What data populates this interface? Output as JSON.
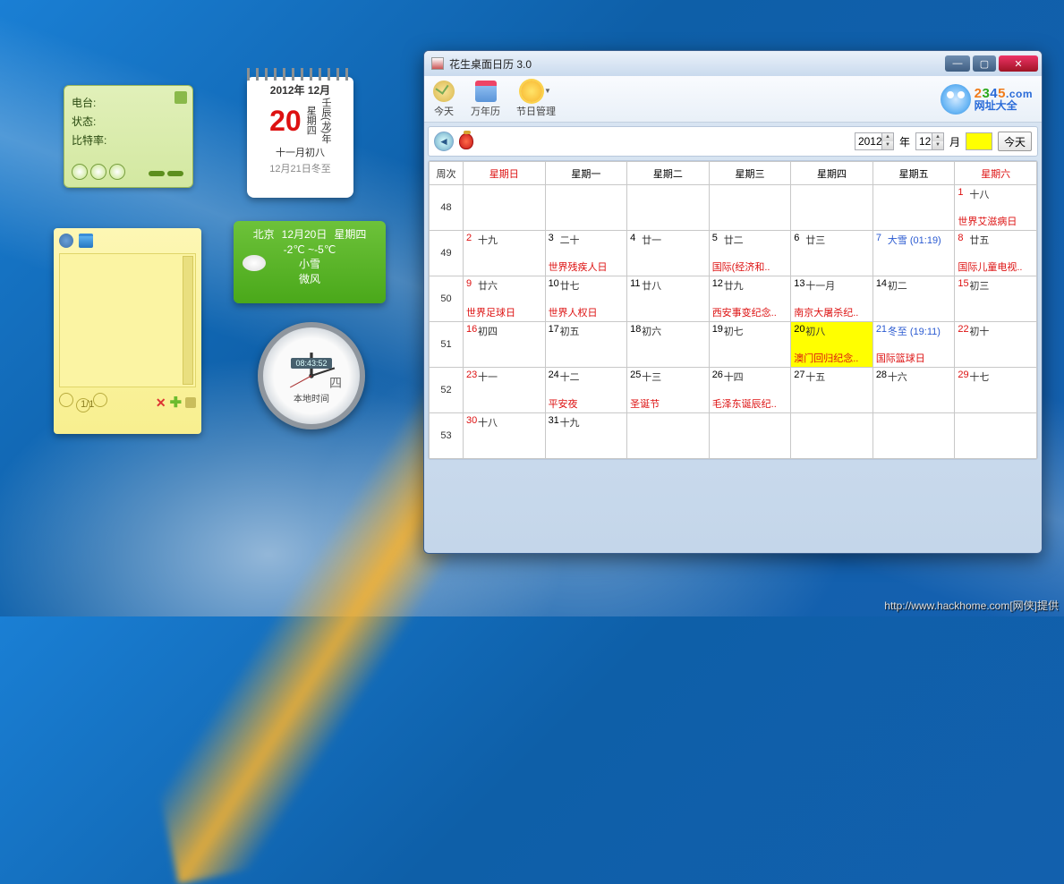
{
  "radio": {
    "station_label": "电台:",
    "status_label": "状态:",
    "bitrate_label": "比特率:"
  },
  "notes": {
    "page": "1/1"
  },
  "tearoff": {
    "title": "2012年 12月",
    "day": "20",
    "weekday": "星期四",
    "ganzhi": "壬辰(龙)年",
    "lunar": "十一月初八",
    "footer": "12月21日冬至"
  },
  "weather": {
    "city": "北京",
    "date": "12月20日",
    "weekday": "星期四",
    "temp": "-2℃ ~-5℃",
    "cond": "小雪",
    "wind": "微风"
  },
  "clock": {
    "digital": "08:43:52",
    "glyph": "四",
    "label": "本地时间"
  },
  "window": {
    "title": "花生桌面日历 3.0",
    "toolbar": {
      "today": "今天",
      "calendar": "万年历",
      "festival": "节日管理"
    },
    "brand": {
      "top": "2345.com",
      "bottom": "网址大全"
    },
    "nav": {
      "year": "2012",
      "year_unit": "年",
      "month": "12",
      "month_unit": "月",
      "today_btn": "今天"
    },
    "headers": {
      "week": "周次",
      "sun": "星期日",
      "mon": "星期一",
      "tue": "星期二",
      "wed": "星期三",
      "thu": "星期四",
      "fri": "星期五",
      "sat": "星期六"
    },
    "weeks": [
      "48",
      "49",
      "50",
      "51",
      "52",
      "53"
    ],
    "grid": [
      [
        null,
        null,
        null,
        null,
        null,
        null,
        {
          "d": "1",
          "l": "十八",
          "note": "世界艾滋病日",
          "nred": true,
          "dred": true
        }
      ],
      [
        {
          "d": "2",
          "l": "十九",
          "dred": true
        },
        {
          "d": "3",
          "l": "二十",
          "note": "世界残疾人日",
          "nred": true
        },
        {
          "d": "4",
          "l": "廿一"
        },
        {
          "d": "5",
          "l": "廿二",
          "note": "国际(经济和..",
          "nred": true
        },
        {
          "d": "6",
          "l": "廿三"
        },
        {
          "d": "7",
          "l": "大雪 (01:19)",
          "dblue": true,
          "lblue": true
        },
        {
          "d": "8",
          "l": "廿五",
          "note": "国际儿童电视..",
          "nred": true,
          "dred": true
        }
      ],
      [
        {
          "d": "9",
          "l": "廿六",
          "note": "世界足球日",
          "nred": true,
          "dred": true
        },
        {
          "d": "10",
          "l": "廿七",
          "note": "世界人权日",
          "nred": true
        },
        {
          "d": "11",
          "l": "廿八"
        },
        {
          "d": "12",
          "l": "廿九",
          "note": "西安事变纪念..",
          "nred": true
        },
        {
          "d": "13",
          "l": "十一月",
          "note": "南京大屠杀纪..",
          "nred": true
        },
        {
          "d": "14",
          "l": "初二"
        },
        {
          "d": "15",
          "l": "初三",
          "dred": true
        }
      ],
      [
        {
          "d": "16",
          "l": "初四",
          "dred": true
        },
        {
          "d": "17",
          "l": "初五"
        },
        {
          "d": "18",
          "l": "初六"
        },
        {
          "d": "19",
          "l": "初七"
        },
        {
          "d": "20",
          "l": "初八",
          "note": "澳门回归纪念..",
          "nred": true,
          "today": true
        },
        {
          "d": "21",
          "l": "冬至 (19:11)",
          "note": "国际篮球日",
          "nred": true,
          "dblue": true,
          "lblue": true
        },
        {
          "d": "22",
          "l": "初十",
          "dred": true
        }
      ],
      [
        {
          "d": "23",
          "l": "十一",
          "dred": true
        },
        {
          "d": "24",
          "l": "十二",
          "note": "平安夜",
          "nred": true
        },
        {
          "d": "25",
          "l": "十三",
          "note": "圣诞节",
          "nred": true
        },
        {
          "d": "26",
          "l": "十四",
          "note": "毛泽东诞辰纪..",
          "nred": true
        },
        {
          "d": "27",
          "l": "十五"
        },
        {
          "d": "28",
          "l": "十六"
        },
        {
          "d": "29",
          "l": "十七",
          "dred": true
        }
      ],
      [
        {
          "d": "30",
          "l": "十八",
          "dred": true
        },
        {
          "d": "31",
          "l": "十九"
        },
        null,
        null,
        null,
        null,
        null
      ]
    ]
  },
  "credit": "http://www.hackhome.com[网侠]提供"
}
